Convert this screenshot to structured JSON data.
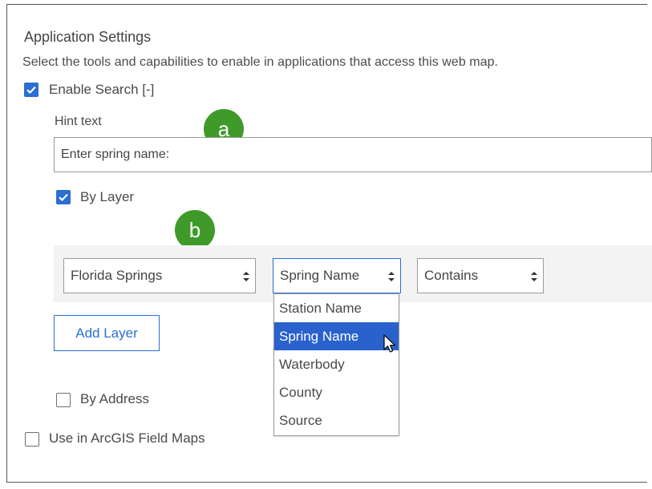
{
  "settings": {
    "title": "Application Settings",
    "description": "Select the tools and capabilities to enable in applications that access this web map.",
    "enable_search": {
      "label": "Enable Search [-]",
      "checked": true
    },
    "hint_text": {
      "label": "Hint text",
      "value": "Enter spring name:"
    },
    "by_layer": {
      "label": "By Layer",
      "checked": true
    },
    "layer_row": {
      "layer_select": "Florida Springs",
      "field_select": "Spring Name",
      "operator_select": "Contains"
    },
    "field_dropdown": {
      "options": [
        "Station Name",
        "Spring Name",
        "Waterbody",
        "County",
        "Source"
      ],
      "selected": "Spring Name"
    },
    "add_layer_label": "Add Layer",
    "by_address": {
      "label": "By Address",
      "checked": false
    },
    "field_maps": {
      "label": "Use in ArcGIS Field Maps",
      "checked": false
    }
  },
  "callouts": {
    "a": "a",
    "b": "b"
  },
  "colors": {
    "accent": "#2a6fd1",
    "selected_option": "#2962cc",
    "badge": "#3f9a2a"
  }
}
